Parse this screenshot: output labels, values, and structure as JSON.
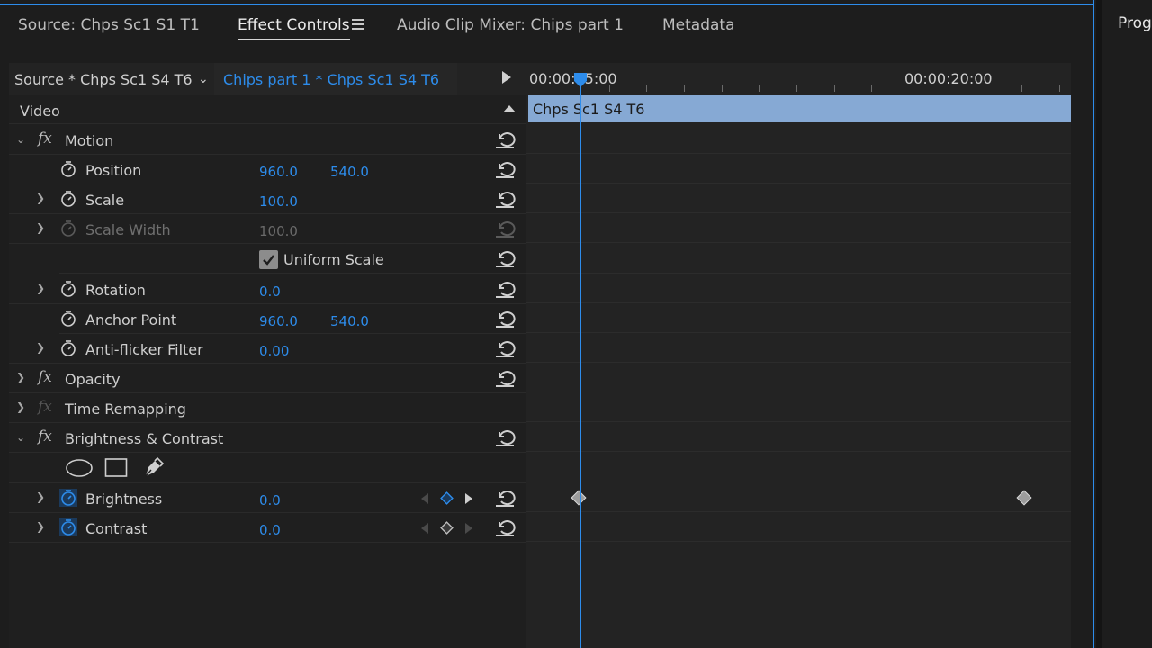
{
  "tabs": [
    {
      "label": "Source: Chps Sc1 S1 T1"
    },
    {
      "label": "Effect Controls"
    },
    {
      "label": "Audio Clip Mixer: Chips part 1"
    },
    {
      "label": "Metadata"
    }
  ],
  "right_panel_tab": "Progr",
  "source_bar": {
    "source": "Source * Chps Sc1 S4 T6",
    "clip": "Chips part 1 * Chps Sc1 S4 T6"
  },
  "section_label": "Video",
  "effects": {
    "motion": {
      "name": "Motion",
      "position": {
        "label": "Position",
        "x": "960.0",
        "y": "540.0"
      },
      "scale": {
        "label": "Scale",
        "value": "100.0"
      },
      "scale_width": {
        "label": "Scale Width",
        "value": "100.0"
      },
      "uniform_scale": {
        "label": "Uniform Scale",
        "checked": true
      },
      "rotation": {
        "label": "Rotation",
        "value": "0.0"
      },
      "anchor_point": {
        "label": "Anchor Point",
        "x": "960.0",
        "y": "540.0"
      },
      "anti_flicker": {
        "label": "Anti-flicker Filter",
        "value": "0.00"
      }
    },
    "opacity": {
      "name": "Opacity"
    },
    "time_remapping": {
      "name": "Time Remapping"
    },
    "brightness_contrast": {
      "name": "Brightness & Contrast",
      "brightness": {
        "label": "Brightness",
        "value": "0.0"
      },
      "contrast": {
        "label": "Contrast",
        "value": "0.0"
      }
    }
  },
  "timeline": {
    "timecodes": [
      "00:00:15:00",
      "00:00:20:00"
    ],
    "clip_name": "Chps Sc1 S4 T6"
  },
  "colors": {
    "accent": "#2d8ceb",
    "clip": "#86a9d4",
    "panel": "#1d1d1d"
  }
}
